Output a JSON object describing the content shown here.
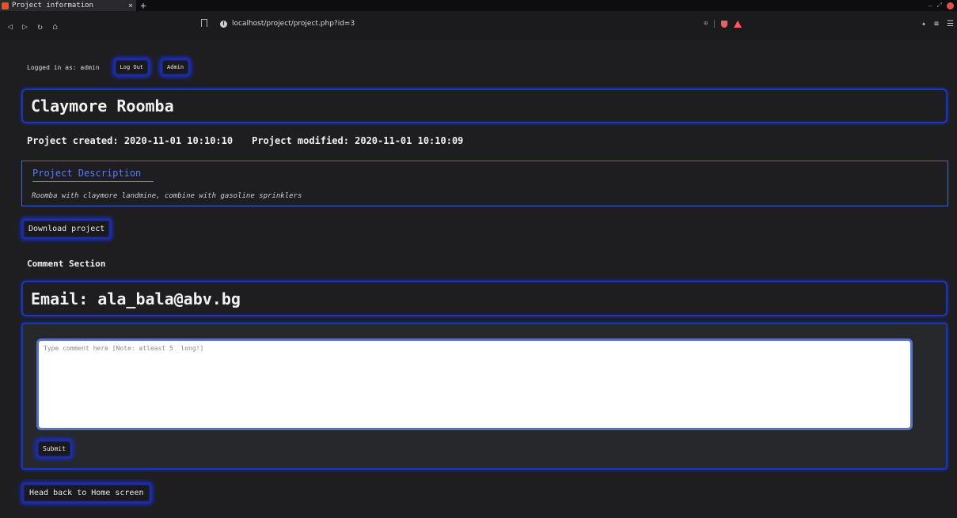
{
  "browser": {
    "tab_title": "Project information",
    "tab_close": "×",
    "new_tab": "+",
    "url": "localhost/project/project.php?id=3",
    "nav_icons": [
      "back-icon",
      "forward-icon",
      "reload-icon",
      "home-icon"
    ],
    "window_controls": [
      "–",
      "⤢"
    ]
  },
  "login": {
    "text": "Logged in as: admin",
    "logout_label": "Log Out",
    "admin_label": "Admin"
  },
  "project": {
    "title": "Claymore Roomba",
    "created": "Project created: 2020-11-01 10:10:10",
    "modified": "Project modified: 2020-11-01 10:10:09",
    "description_heading": "Project Description",
    "description": "Roomba with claymore landmine, combine with gasoline sprinklers",
    "download_label": "Download project"
  },
  "comments": {
    "heading": "Comment Section",
    "email": "Email: ala_bala@abv.bg",
    "placeholder": "Type comment here [Note: atleast 5  long!]",
    "submit_label": "Submit"
  },
  "footer": {
    "home_label": "Head back to Home screen"
  },
  "colors": {
    "accent_glow": "#1a2ed0",
    "border_blue": "#1d36b8",
    "link_blue": "#5b7af0",
    "background": "#1e1e21"
  }
}
